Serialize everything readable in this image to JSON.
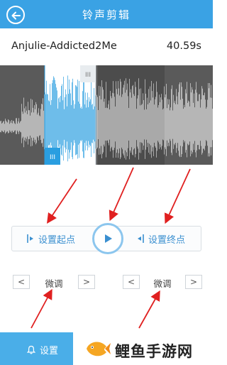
{
  "header": {
    "title": "铃声剪辑",
    "back_icon": "back-arrow-icon"
  },
  "track": {
    "name": "Anjulie-Addicted2Me",
    "duration": "40.59s"
  },
  "waveform": {
    "selection_start_fraction": 0.21,
    "selection_end_fraction": 0.45,
    "handle_start_label": "III",
    "handle_end_label": "III"
  },
  "controls": {
    "set_start_label": "设置起点",
    "set_end_label": "设置终点",
    "play_icon": "play-icon"
  },
  "fine_tune": {
    "left_label": "微调",
    "right_label": "微调",
    "prev_symbol": "<",
    "next_symbol": ">"
  },
  "footer": {
    "set_label": "设置",
    "brand_text": "鲤鱼手游网"
  },
  "colors": {
    "accent": "#3aa2e4",
    "selection": "#2a9ee0",
    "annotation_arrow": "#e02020"
  }
}
